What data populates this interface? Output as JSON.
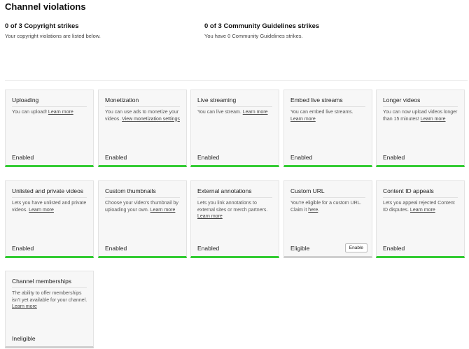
{
  "page_title": "Channel violations",
  "strikes": {
    "copyright": {
      "title": "0 of 3 Copyright strikes",
      "desc": "Your copyright violations are listed below."
    },
    "community": {
      "title": "0 of 3 Community Guidelines strikes",
      "desc": "You have 0 Community Guidelines strikes."
    }
  },
  "features": [
    {
      "title": "Uploading",
      "desc": "You can upload!",
      "link": "Learn more",
      "status": "Enabled",
      "bar": "green"
    },
    {
      "title": "Monetization",
      "desc": "You can use ads to monetize your videos.",
      "link": "View monetization settings",
      "status": "Enabled",
      "bar": "green"
    },
    {
      "title": "Live streaming",
      "desc": "You can live stream.",
      "link": "Learn more",
      "status": "Enabled",
      "bar": "green"
    },
    {
      "title": "Embed live streams",
      "desc": "You can embed live streams.",
      "link": "Learn more",
      "status": "Enabled",
      "bar": "green"
    },
    {
      "title": "Longer videos",
      "desc": "You can now upload videos longer than 15 minutes!",
      "link": "Learn more",
      "status": "Enabled",
      "bar": "green"
    },
    {
      "title": "Unlisted and private videos",
      "desc": "Lets you have unlisted and private videos.",
      "link": "Learn more",
      "status": "Enabled",
      "bar": "green"
    },
    {
      "title": "Custom thumbnails",
      "desc": "Choose your video's thumbnail by uploading your own.",
      "link": "Learn more",
      "status": "Enabled",
      "bar": "green"
    },
    {
      "title": "External annotations",
      "desc": "Lets you link annotations to external sites or merch partners.",
      "link": "Learn more",
      "status": "Enabled",
      "bar": "green"
    },
    {
      "title": "Custom URL",
      "desc": "You're eligible for a custom URL. Claim it",
      "link": "here",
      "link_suffix": ".",
      "status": "Eligible",
      "button": "Enable",
      "bar": "grey"
    },
    {
      "title": "Content ID appeals",
      "desc": "Lets you appeal rejected Content ID disputes.",
      "link": "Learn more",
      "status": "Enabled",
      "bar": "green"
    },
    {
      "title": "Channel memberships",
      "desc": "The ability to offer memberships isn't yet available for your channel.",
      "link": "Learn more",
      "status": "Ineligible",
      "bar": "grey"
    }
  ]
}
